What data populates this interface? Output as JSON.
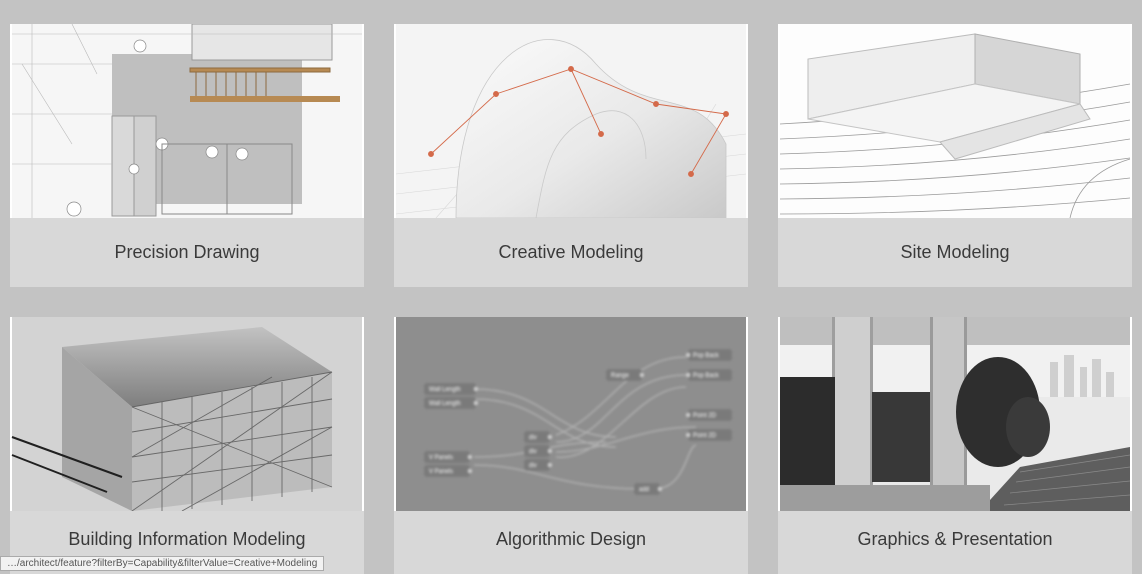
{
  "cards": [
    {
      "title": "Precision Drawing"
    },
    {
      "title": "Creative Modeling"
    },
    {
      "title": "Site Modeling"
    },
    {
      "title": "Building Information Modeling"
    },
    {
      "title": "Algorithmic Design"
    },
    {
      "title": "Graphics & Presentation"
    }
  ],
  "status_text": "…/architect/feature?filterBy=Capability&filterValue=Creative+Modeling",
  "algo_nodes": {
    "wall_length": "Wall Length",
    "v_panels": "V Panels",
    "div": "div",
    "add": "add",
    "range": "Range",
    "pop_back": "Pop Back",
    "point_2d": "Point 2D"
  }
}
